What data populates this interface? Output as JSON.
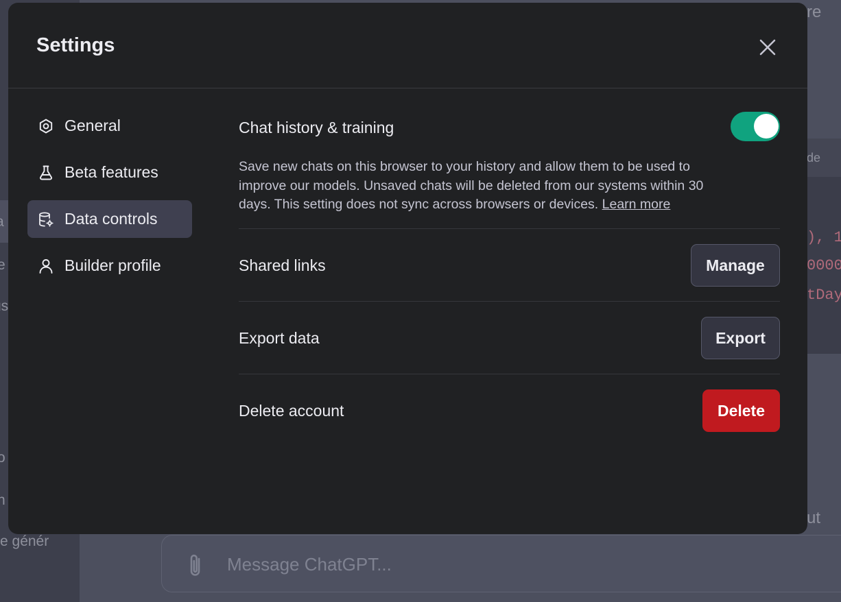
{
  "background": {
    "sidebar_fragments": [
      "a",
      "e",
      "us",
      "o",
      "n",
      "e génér"
    ],
    "top_fragment": "re",
    "code_header": "de",
    "code_fragments": [
      "), 1",
      "0000",
      "tDay"
    ],
    "main_fragment": "ut",
    "composer_placeholder": "Message ChatGPT..."
  },
  "modal": {
    "title": "Settings",
    "close_icon": "close-icon"
  },
  "nav": {
    "items": [
      {
        "label": "General",
        "icon": "gear-icon",
        "active": false
      },
      {
        "label": "Beta features",
        "icon": "flask-icon",
        "active": false
      },
      {
        "label": "Data controls",
        "icon": "database-gear-icon",
        "active": true
      },
      {
        "label": "Builder profile",
        "icon": "person-icon",
        "active": false
      }
    ]
  },
  "data_controls": {
    "history": {
      "title": "Chat history & training",
      "enabled": true,
      "description": "Save new chats on this browser to your history and allow them to be used to improve our models. Unsaved chats will be deleted from our systems within 30 days. This setting does not sync across browsers or devices.",
      "learn_more": "Learn more"
    },
    "shared_links": {
      "title": "Shared links",
      "button": "Manage"
    },
    "export": {
      "title": "Export data",
      "button": "Export"
    },
    "delete": {
      "title": "Delete account",
      "button": "Delete"
    }
  },
  "colors": {
    "modal_bg": "#202123",
    "accent_toggle": "#10a37f",
    "danger": "#c01a1f",
    "nav_active": "#3f4050"
  }
}
